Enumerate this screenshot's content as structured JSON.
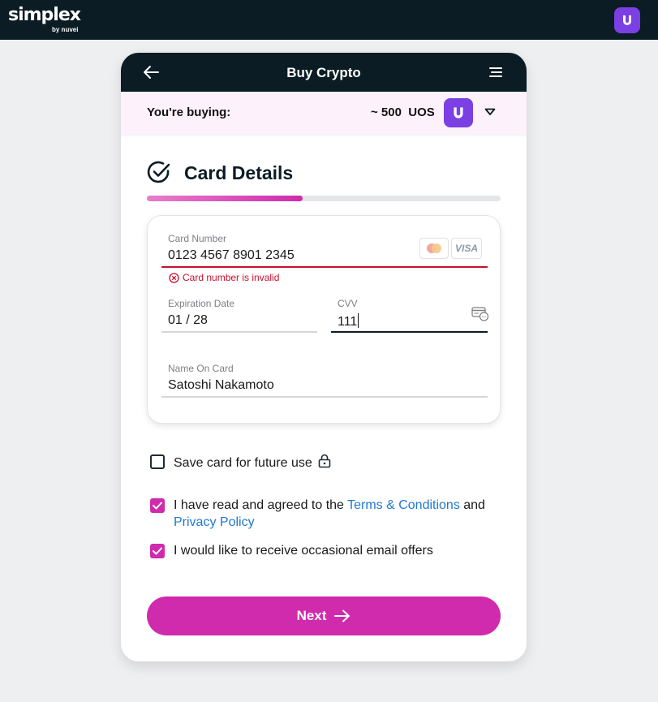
{
  "app": {
    "logo_text": "simplex",
    "logo_sub": "by nuvei"
  },
  "header": {
    "title": "Buy Crypto"
  },
  "purchase": {
    "label": "You're buying:",
    "amount": "~ 500  UOS"
  },
  "section": {
    "title": "Card Details",
    "progress_fraction": 0.44
  },
  "form": {
    "card_number_label": "Card Number",
    "card_number_value": "0123 4567 8901 2345",
    "card_error": "Card number is invalid",
    "visa_label": "VISA",
    "expiration_label": "Expiration Date",
    "expiration_value": "01 / 28",
    "cvv_label": "CVV",
    "cvv_value": "111",
    "name_label": "Name On Card",
    "name_value": "Satoshi Nakamoto"
  },
  "options": {
    "save_card": "Save card for future use",
    "terms_prefix": "I have read and agreed to the ",
    "terms_link": "Terms & Conditions",
    "terms_mid": " and",
    "privacy_link": "Privacy Policy",
    "email_offers": "I would like to receive occasional email offers",
    "save_card_checked": false,
    "terms_checked": true,
    "email_checked": true
  },
  "actions": {
    "next_label": "Next"
  },
  "colors": {
    "brand_dark": "#0b1c24",
    "accent_magenta": "#d02aad",
    "coin_purple": "#7b3fe4",
    "error_red": "#c8102e",
    "link_blue": "#1f78d1"
  },
  "icons": [
    "back-arrow-icon",
    "menu-icon",
    "uos-coin-icon",
    "chevron-down-icon",
    "check-circle-icon",
    "mastercard-icon",
    "visa-icon",
    "error-icon",
    "cvv-card-icon",
    "lock-icon",
    "checkbox-icon",
    "arrow-right-icon"
  ]
}
